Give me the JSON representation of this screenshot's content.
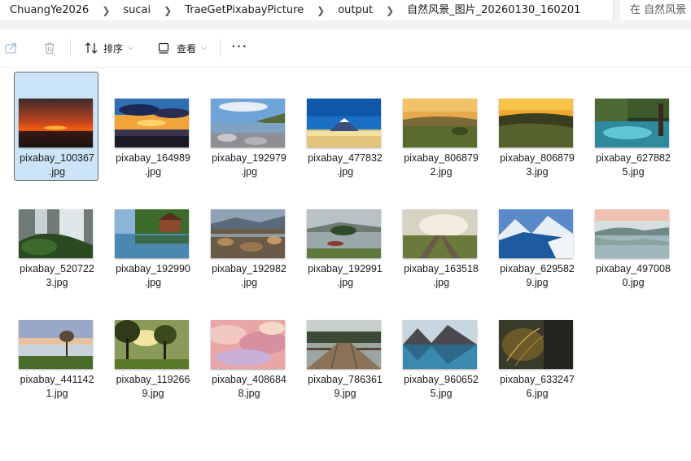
{
  "address_bar": {
    "crumbs": [
      "ChuangYe2026",
      "sucai",
      "TraeGetPixabayPicture",
      "output",
      "自然风景_图片_20260130_160201"
    ],
    "search_placeholder": "在 自然风景"
  },
  "toolbar": {
    "sort_label": "排序",
    "view_label": "查看",
    "more_label": "···"
  },
  "files": [
    {
      "line1": "pixabay_100367",
      "line2": ".jpg",
      "selected": true,
      "thumb": "sunset-red"
    },
    {
      "line1": "pixabay_164989",
      "line2": ".jpg",
      "thumb": "sunset-clouds"
    },
    {
      "line1": "pixabay_192979",
      "line2": ".jpg",
      "thumb": "rocky-shore"
    },
    {
      "line1": "pixabay_477832",
      "line2": ".jpg",
      "thumb": "mount-fuji"
    },
    {
      "line1": "pixabay_806879",
      "line2": "2.jpg",
      "thumb": "golden-meadow"
    },
    {
      "line1": "pixabay_806879",
      "line2": "3.jpg",
      "thumb": "golden-hills"
    },
    {
      "line1": "pixabay_627882",
      "line2": "5.jpg",
      "thumb": "forest-lake"
    },
    {
      "line1": "pixabay_520722",
      "line2": "3.jpg",
      "thumb": "waterfall"
    },
    {
      "line1": "pixabay_192990",
      "line2": ".jpg",
      "thumb": "lake-house"
    },
    {
      "line1": "pixabay_192982",
      "line2": ".jpg",
      "thumb": "rocky-stream"
    },
    {
      "line1": "pixabay_192991",
      "line2": ".jpg",
      "thumb": "island-lake"
    },
    {
      "line1": "pixabay_163518",
      "line2": ".jpg",
      "thumb": "railroad-fog"
    },
    {
      "line1": "pixabay_629582",
      "line2": "9.jpg",
      "thumb": "snowy-mountains"
    },
    {
      "line1": "pixabay_497008",
      "line2": "0.jpg",
      "thumb": "misty-lake"
    },
    {
      "line1": "pixabay_441142",
      "line2": "1.jpg",
      "thumb": "lone-tree"
    },
    {
      "line1": "pixabay_119266",
      "line2": "9.jpg",
      "thumb": "trees-sunlight"
    },
    {
      "line1": "pixabay_408684",
      "line2": "8.jpg",
      "thumb": "pink-clouds"
    },
    {
      "line1": "pixabay_786361",
      "line2": "9.jpg",
      "thumb": "wooden-pier"
    },
    {
      "line1": "pixabay_960652",
      "line2": "5.jpg",
      "thumb": "mountain-reflection"
    },
    {
      "line1": "pixabay_633247",
      "line2": "6.jpg",
      "thumb": "dark-grass"
    }
  ],
  "colors": {
    "selection_bg": "#cce4f7",
    "address_bg": "#f3f3f3"
  }
}
